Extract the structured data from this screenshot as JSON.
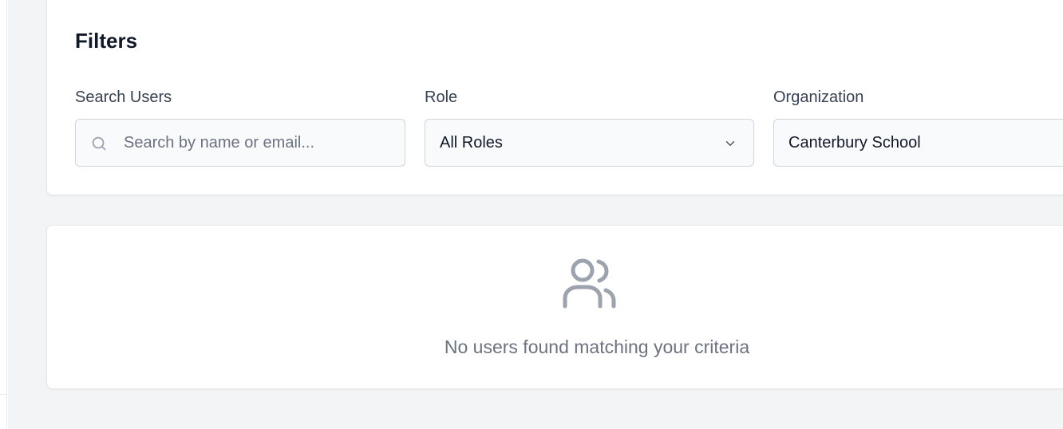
{
  "filters": {
    "title": "Filters",
    "search": {
      "label": "Search Users",
      "placeholder": "Search by name or email...",
      "icon": "search-icon"
    },
    "role": {
      "label": "Role",
      "selected": "All Roles",
      "icon": "chevron-down-icon"
    },
    "organization": {
      "label": "Organization",
      "selected": "Canterbury School"
    }
  },
  "results": {
    "empty_icon": "users-icon",
    "empty_message": "No users found matching your criteria"
  },
  "colors": {
    "page_background": "#f3f4f6",
    "card_background": "#ffffff",
    "input_background": "#f9fafb",
    "muted_text": "#6b7280",
    "icon_gray": "#9ca3af"
  }
}
